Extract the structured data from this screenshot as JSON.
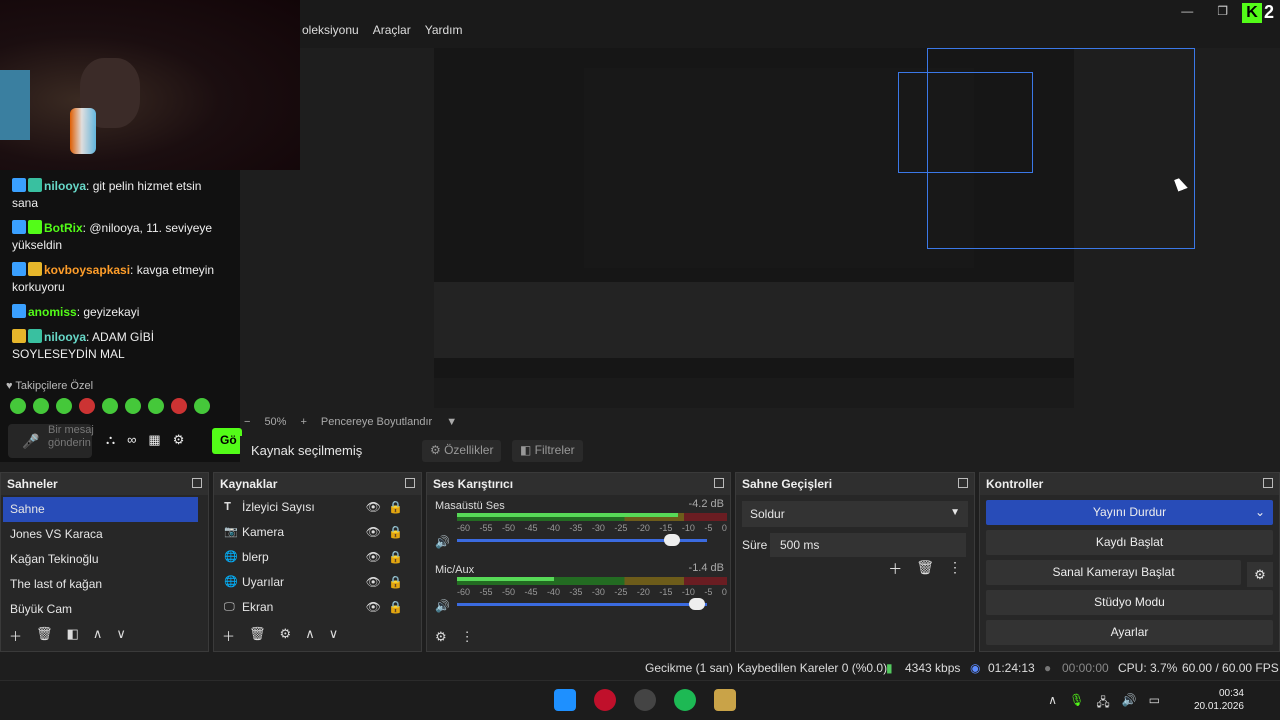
{
  "menubar": {
    "menus": [
      "oleksiyonu",
      "Araçlar",
      "Yardım"
    ],
    "window_controls": [
      "minimize-icon",
      "restore-icon"
    ],
    "kick_letter": "K",
    "kick_number": "2"
  },
  "chat": {
    "messages": [
      {
        "user": "nilooya",
        "text": " git pelin hizmet etsin sana"
      },
      {
        "user": "BotRix",
        "text": " @nilooya, 11. seviyeye yükseldin"
      },
      {
        "user": "kovboysapkasi",
        "text": " kavga etmeyin korkuyoru"
      },
      {
        "user": "anomiss",
        "text": " geyizekayi"
      },
      {
        "user": "nilooya",
        "text": " ADAM GİBİ SOYLESEYDİN MAL"
      }
    ],
    "followers_label": "Takipçilere Özel",
    "input_placeholder": "Bir mesaj gönderin",
    "send_label": "Gö"
  },
  "preview": {
    "zoom": "50%",
    "fit_label": "Pencereye Boyutlandır"
  },
  "propbar": {
    "source_label": "Kaynak seçilmemiş",
    "properties_label": "Özellikler",
    "filters_label": "Filtreler"
  },
  "scenes": {
    "title": "Sahneler",
    "items": [
      "Sahne",
      "Jones VS Karaca",
      "Kağan Tekinoğlu",
      "The last of kağan",
      "Büyük Cam"
    ]
  },
  "sources": {
    "title": "Kaynaklar",
    "items": [
      "İzleyici Sayısı",
      "Kamera",
      "blerp",
      "Uyarılar",
      "Ekran"
    ]
  },
  "mixer": {
    "title": "Ses Karıştırıcı",
    "channels": [
      {
        "name": "Masaüstü Ses",
        "db": "-4.2 dB",
        "level": 0.82,
        "volume": 0.86
      },
      {
        "name": "Mic/Aux",
        "db": "-1.4 dB",
        "level": 0.36,
        "volume": 0.96
      }
    ],
    "ticks": [
      "-60",
      "-55",
      "-50",
      "-45",
      "-40",
      "-35",
      "-30",
      "-25",
      "-20",
      "-15",
      "-10",
      "-5",
      "0"
    ]
  },
  "transitions": {
    "title": "Sahne Geçişleri",
    "selected": "Soldur",
    "duration_label": "Süre",
    "duration_value": "500 ms"
  },
  "controls": {
    "title": "Kontroller",
    "stop_stream": "Yayını Durdur",
    "start_recording": "Kaydı Başlat",
    "start_virtualcam": "Sanal Kamerayı Başlat",
    "studio_mode": "Stüdyo Modu",
    "settings": "Ayarlar"
  },
  "status": {
    "delay": "Gecikme (1 san)",
    "dropped": "Kaybedilen Kareler 0 (%0.0)",
    "bitrate": "4343 kbps",
    "stream_time": "01:24:13",
    "rec_time": "00:00:00",
    "cpu": "CPU: 3.7%",
    "fps": "60.00 / 60.00 FPS"
  },
  "taskbar": {
    "time": "00:34",
    "date": "20.01.2026"
  }
}
